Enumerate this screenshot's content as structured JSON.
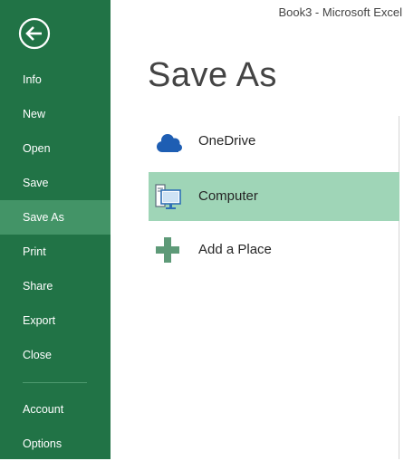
{
  "window": {
    "title": "Book3 - Microsoft Excel"
  },
  "backstage": {
    "back_label": "Back",
    "nav_items": [
      {
        "label": "Info",
        "selected": false
      },
      {
        "label": "New",
        "selected": false
      },
      {
        "label": "Open",
        "selected": false
      },
      {
        "label": "Save",
        "selected": false
      },
      {
        "label": "Save As",
        "selected": true
      },
      {
        "label": "Print",
        "selected": false
      },
      {
        "label": "Share",
        "selected": false
      },
      {
        "label": "Export",
        "selected": false
      },
      {
        "label": "Close",
        "selected": false
      },
      {
        "label": "Account",
        "selected": false
      },
      {
        "label": "Options",
        "selected": false
      }
    ]
  },
  "main": {
    "title": "Save As",
    "places": [
      {
        "label": "OneDrive",
        "icon": "onedrive-cloud-icon",
        "selected": false
      },
      {
        "label": "Computer",
        "icon": "computer-icon",
        "selected": true
      },
      {
        "label": "Add a Place",
        "icon": "plus-icon",
        "selected": false
      }
    ]
  },
  "colors": {
    "sidebar": "#217346",
    "sidebar_selected": "#439467",
    "place_selected": "#9fd5b7",
    "onedrive_blue": "#1e5eb3",
    "plus_green": "#5e9a78"
  }
}
